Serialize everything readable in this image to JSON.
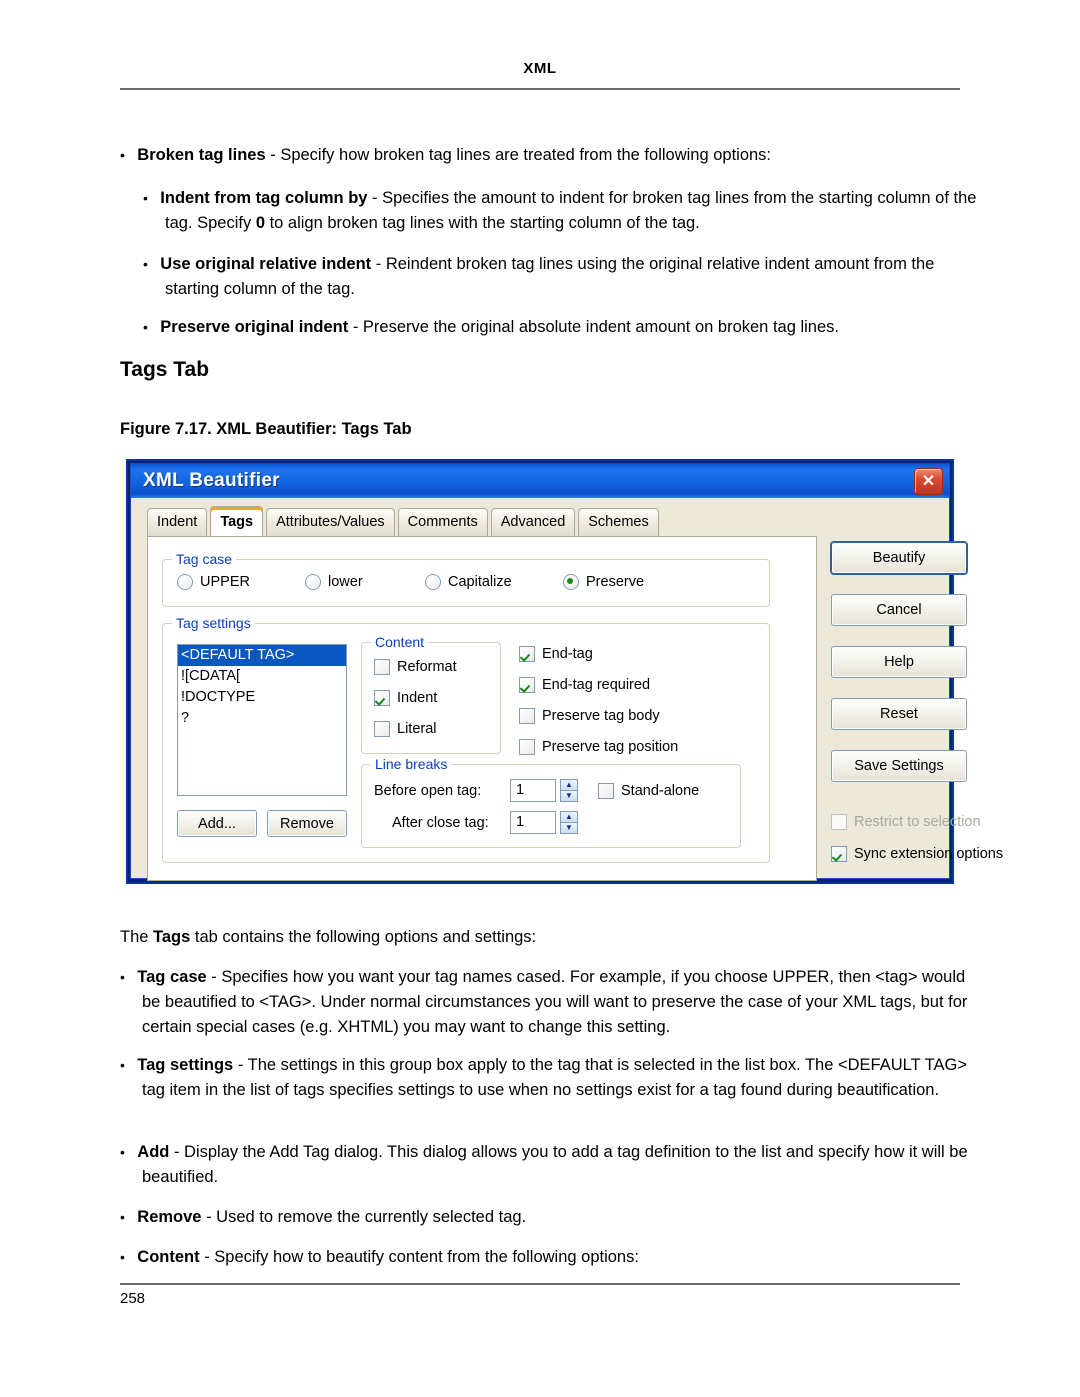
{
  "page": {
    "running_head": "XML",
    "folio": "258",
    "section_heading": "Tags Tab",
    "figure_caption": "Figure 7.17.  XML Beautifier: Tags Tab"
  },
  "top_bullets": [
    {
      "level": 1,
      "term": "Broken tag lines",
      "rest": " - Specify how broken tag lines are treated from the following options:"
    },
    {
      "level": 2,
      "term": "Indent from tag column by",
      "rest": " - Specifies the amount to indent for broken tag lines from the starting column of the tag. Specify ",
      "bold_mid": "0",
      "rest2": " to align broken tag lines with the starting column of the tag."
    },
    {
      "level": 2,
      "term": "Use original relative indent",
      "rest": " - Reindent broken tag lines using the original relative indent amount from the starting column of the tag."
    },
    {
      "level": 2,
      "term": "Preserve original indent",
      "rest": " - Preserve the original absolute indent amount on broken tag lines."
    }
  ],
  "intro": {
    "before": "The ",
    "bold": "Tags",
    "after": " tab contains the following options and settings:"
  },
  "bottom_bullets": [
    {
      "term": "Tag case",
      "rest": " - Specifies how you want your tag names cased. For example, if you choose UPPER, then <tag> would be beautified to <TAG>. Under normal circumstances you will want to preserve the case of your XML tags, but for certain special cases (e.g. XHTML) you may want to change this setting."
    },
    {
      "term": "Tag settings",
      "rest": " - The settings in this group box apply to the tag that is selected in the list box. The <DEFAULT TAG> tag item in the list of tags specifies settings to use when no settings exist for a tag found during beautification."
    },
    {
      "term": "Add",
      "rest": " - Display the Add Tag dialog. This dialog allows you to add a tag definition to the list and specify how it will be beautified."
    },
    {
      "term": "Remove",
      "rest": " - Used to remove the currently selected tag."
    },
    {
      "term": "Content",
      "rest": " - Specify how to beautify content from the following options:"
    }
  ],
  "dialog": {
    "title": "XML Beautifier",
    "close_label": "✕",
    "tabs": [
      {
        "label": "Indent",
        "active": false
      },
      {
        "label": "Tags",
        "active": true
      },
      {
        "label": "Attributes/Values",
        "active": false
      },
      {
        "label": "Comments",
        "active": false
      },
      {
        "label": "Advanced",
        "active": false
      },
      {
        "label": "Schemes",
        "active": false
      }
    ],
    "tag_case": {
      "legend": "Tag case",
      "options": [
        {
          "label": "UPPER",
          "selected": false
        },
        {
          "label": "lower",
          "selected": false
        },
        {
          "label": "Capitalize",
          "selected": false
        },
        {
          "label": "Preserve",
          "selected": true
        }
      ]
    },
    "tag_settings": {
      "legend": "Tag settings",
      "list_items": [
        {
          "label": "<DEFAULT TAG>",
          "selected": true
        },
        {
          "label": "![CDATA[",
          "selected": false
        },
        {
          "label": "!DOCTYPE",
          "selected": false
        },
        {
          "label": "?",
          "selected": false
        }
      ],
      "add_button": "Add...",
      "remove_button": "Remove",
      "content": {
        "legend": "Content",
        "options": [
          {
            "label": "Reformat",
            "checked": false
          },
          {
            "label": "Indent",
            "checked": true
          },
          {
            "label": "Literal",
            "checked": false
          }
        ]
      },
      "tag_options": [
        {
          "label": "End-tag",
          "checked": true
        },
        {
          "label": "End-tag required",
          "checked": true
        },
        {
          "label": "Preserve tag body",
          "checked": false
        },
        {
          "label": "Preserve tag position",
          "checked": false
        }
      ],
      "line_breaks": {
        "legend": "Line breaks",
        "before_open_tag": {
          "label": "Before open tag:",
          "value": "1"
        },
        "after_close_tag": {
          "label": "After close tag:",
          "value": "1"
        },
        "stand_alone": {
          "label": "Stand-alone",
          "checked": false
        }
      }
    },
    "buttons": [
      {
        "label": "Beautify",
        "default": true
      },
      {
        "label": "Cancel",
        "default": false
      },
      {
        "label": "Help",
        "default": false
      },
      {
        "label": "Reset",
        "default": false
      },
      {
        "label": "Save Settings",
        "default": false
      }
    ],
    "side_checks": [
      {
        "label": "Restrict to selection",
        "checked": false,
        "disabled": true
      },
      {
        "label": "Sync extension options",
        "checked": true,
        "disabled": false
      }
    ]
  },
  "colors": {
    "title_bar": "#1265e0",
    "close_red": "#c1321c",
    "selection_blue": "#0a57bf",
    "group_label": "#0b3fbd",
    "active_tab_accent": "#f5a623",
    "dialog_face": "#ece9d8",
    "check_green": "#178a17"
  }
}
